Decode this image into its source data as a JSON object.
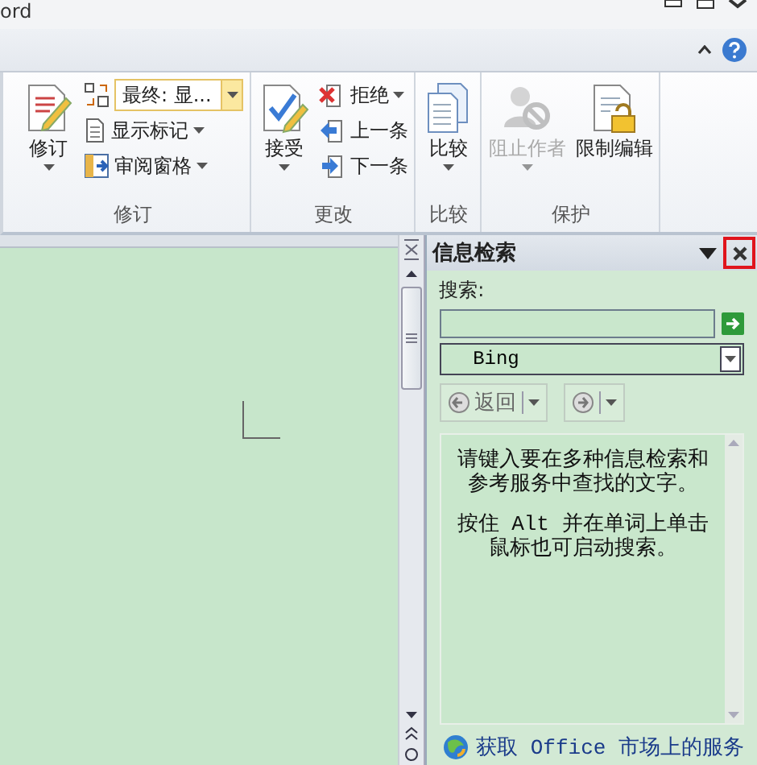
{
  "window": {
    "title": "ord"
  },
  "ribbon": {
    "groups": [
      {
        "label": "修订",
        "items": [
          {
            "kind": "large",
            "label": "修订",
            "dropdown": true,
            "disabled": false
          },
          {
            "kind": "combo",
            "value": "最终: 显..."
          },
          {
            "kind": "small",
            "label": "显示标记",
            "dropdown": true,
            "disabled": false
          },
          {
            "kind": "small",
            "label": "审阅窗格",
            "dropdown": true,
            "disabled": false
          }
        ]
      },
      {
        "label": "更改",
        "items": [
          {
            "kind": "large",
            "label": "接受",
            "dropdown": true,
            "disabled": false
          },
          {
            "kind": "small",
            "label": "拒绝",
            "dropdown": true,
            "disabled": false
          },
          {
            "kind": "small",
            "label": "上一条",
            "dropdown": false,
            "disabled": false
          },
          {
            "kind": "small",
            "label": "下一条",
            "dropdown": false,
            "disabled": false
          }
        ]
      },
      {
        "label": "比较",
        "items": [
          {
            "kind": "large",
            "label": "比较",
            "dropdown": true,
            "disabled": false
          }
        ]
      },
      {
        "label": "保护",
        "items": [
          {
            "kind": "large",
            "label": "阻止作者",
            "dropdown": true,
            "disabled": true
          },
          {
            "kind": "large",
            "label": "限制编辑",
            "dropdown": false,
            "disabled": false
          }
        ]
      }
    ]
  },
  "research_pane": {
    "title": "信息检索",
    "search_label": "搜索:",
    "source": "Bing",
    "back_button": {
      "label": "返回",
      "disabled": true
    },
    "forward_button": {
      "disabled": true
    },
    "message": [
      "请键入要在多种信息检索和参考服务中查找的文字。",
      "按住 Alt 并在单词上单击鼠标也可启动搜索。"
    ],
    "footer_link": "获取 Office 市场上的服务"
  }
}
